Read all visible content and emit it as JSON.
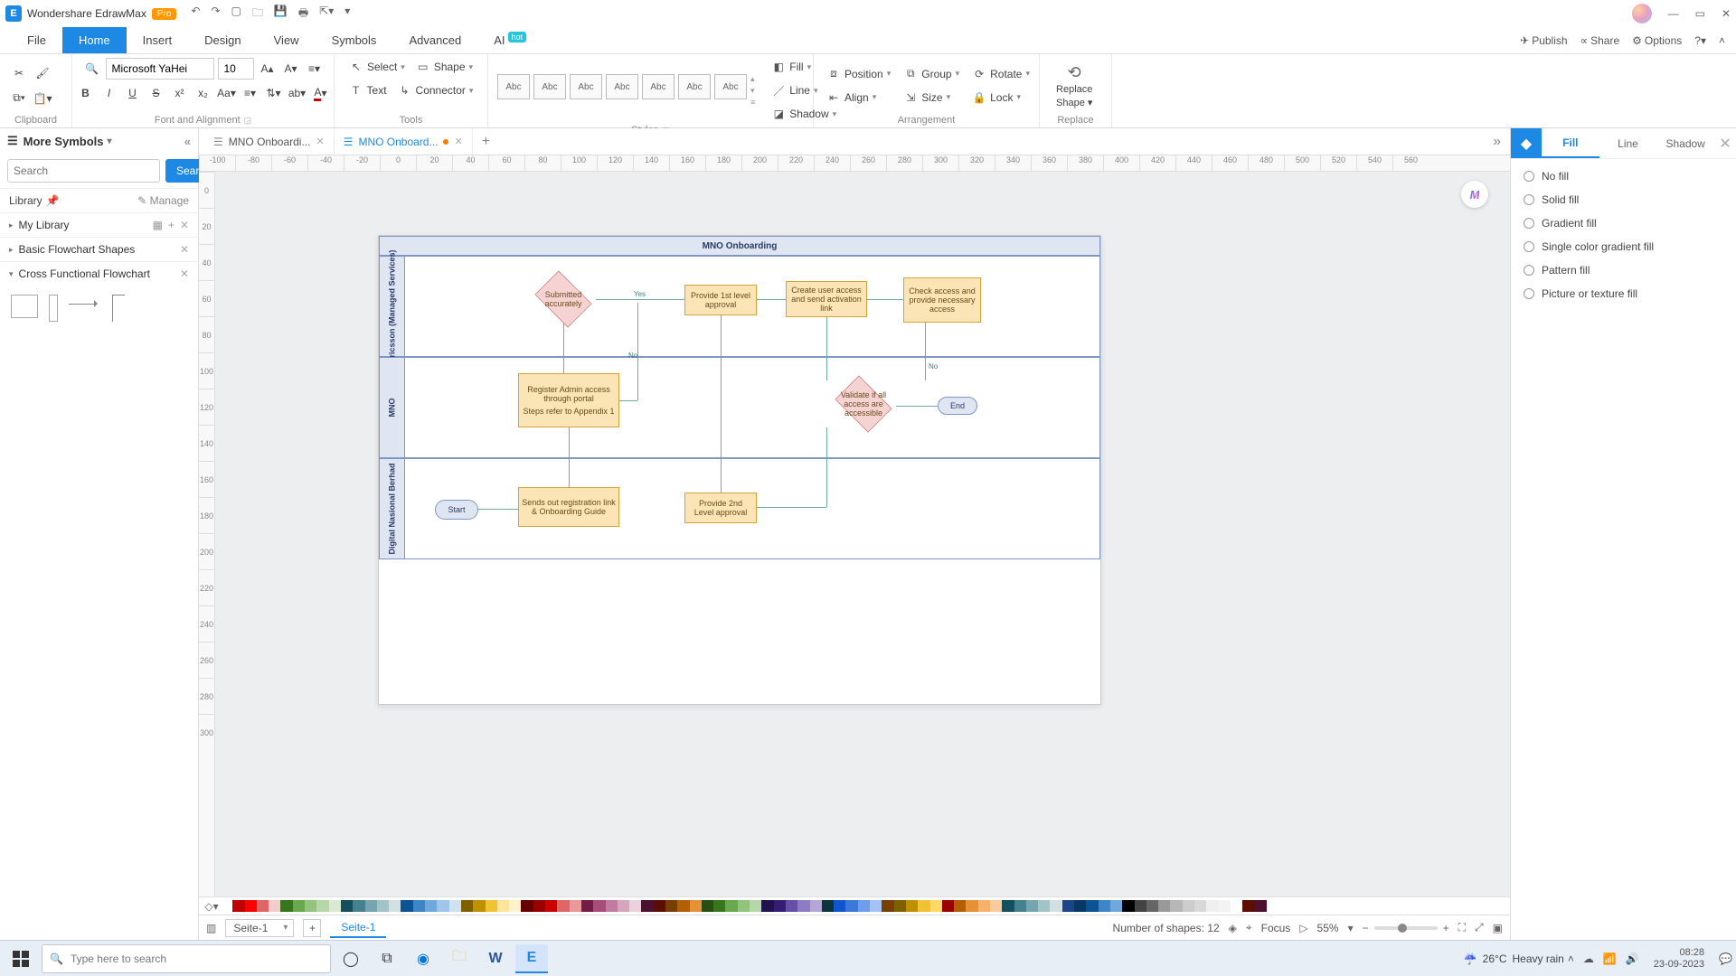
{
  "titlebar": {
    "app": "Wondershare EdrawMax",
    "badge": "Pro"
  },
  "menu": {
    "tabs": [
      "File",
      "Home",
      "Insert",
      "Design",
      "View",
      "Symbols",
      "Advanced",
      "AI"
    ],
    "active": 1,
    "hot": "hot",
    "right": {
      "publish": "Publish",
      "share": "Share",
      "options": "Options"
    }
  },
  "ribbon": {
    "clipboard": {
      "label": "Clipboard"
    },
    "font": {
      "name": "Microsoft YaHei",
      "size": "10",
      "label": "Font and Alignment"
    },
    "tools": {
      "select": "Select",
      "shape": "Shape",
      "text": "Text",
      "connector": "Connector",
      "label": "Tools"
    },
    "styles": {
      "swatch": "Abc",
      "label": "Styles",
      "fill": "Fill",
      "line": "Line",
      "shadow": "Shadow"
    },
    "arrange": {
      "position": "Position",
      "group": "Group",
      "rotate": "Rotate",
      "align": "Align",
      "size": "Size",
      "lock": "Lock",
      "label": "Arrangement"
    },
    "replace": {
      "top": "Replace",
      "bottom": "Shape",
      "label": "Replace"
    }
  },
  "symbols": {
    "title": "More Symbols",
    "search_ph": "Search",
    "search_btn": "Search",
    "library": "Library",
    "manage": "Manage",
    "mylib": "My Library",
    "cat1": "Basic Flowchart Shapes",
    "cat2": "Cross Functional Flowchart"
  },
  "doctabs": {
    "t1": "MNO Onboardi...",
    "t2": "MNO Onboard..."
  },
  "ruler_h": [
    "-100",
    "-80",
    "-60",
    "-40",
    "-20",
    "0",
    "20",
    "40",
    "60",
    "80",
    "100",
    "120",
    "140",
    "160",
    "180",
    "200",
    "220",
    "240",
    "260",
    "280",
    "300",
    "320",
    "340",
    "360",
    "380",
    "400",
    "420",
    "440",
    "460",
    "480",
    "500",
    "520",
    "540",
    "560"
  ],
  "ruler_v": [
    "0",
    "20",
    "40",
    "60",
    "80",
    "100",
    "120",
    "140",
    "160",
    "180",
    "200",
    "220",
    "240",
    "260",
    "280",
    "300"
  ],
  "diagram": {
    "title": "MNO Onboarding",
    "lane1": "Ericsson (Managed Services)",
    "lane2": "MNO",
    "lane3": "Digital Nasional Berhad",
    "start": "Start",
    "end": "End",
    "submitted": "Submitted accurately",
    "provide1": "Provide 1st level approval",
    "create": "Create user access and send activation link",
    "check": "Check access and provide necessary access",
    "register": "Register Admin access through portal",
    "steps": "Steps refer to Appendix 1",
    "sends": "Sends out registration link & Onboarding Guide",
    "provide2": "Provide 2nd Level approval",
    "validate": "Validate if all access are accessible",
    "yes": "Yes",
    "no": "No",
    "ai": "M"
  },
  "format": {
    "tabs": [
      "Fill",
      "Line",
      "Shadow"
    ],
    "opts": [
      "No fill",
      "Solid fill",
      "Gradient fill",
      "Single color gradient fill",
      "Pattern fill",
      "Picture or texture fill"
    ]
  },
  "status": {
    "page": "Seite-1",
    "ptab": "Seite-1",
    "shapes": "Number of shapes: 12",
    "focus": "Focus",
    "zoom": "55%"
  },
  "taskbar": {
    "search": "Type here to search",
    "weather_t": "26°C",
    "weather_s": "Heavy rain",
    "time": "08:28",
    "date": "23-09-2023"
  },
  "colors": [
    "#ffffff",
    "#c00000",
    "#ff0000",
    "#e06666",
    "#f4cccc",
    "#38761d",
    "#6aa84f",
    "#93c47d",
    "#b6d7a8",
    "#d9ead3",
    "#134f5c",
    "#45818e",
    "#76a5af",
    "#a2c4c9",
    "#d0e0e3",
    "#0b5394",
    "#3d85c6",
    "#6fa8dc",
    "#9fc5e8",
    "#cfe2f3",
    "#7f6000",
    "#bf9000",
    "#f1c232",
    "#ffe599",
    "#fff2cc",
    "#660000",
    "#990000",
    "#cc0000",
    "#e06666",
    "#ea9999",
    "#741b47",
    "#a64d79",
    "#c27ba0",
    "#d5a6bd",
    "#ead1dc",
    "#4c1130",
    "#5b0f00",
    "#783f04",
    "#b45f06",
    "#e69138",
    "#274e13",
    "#38761d",
    "#6aa84f",
    "#93c47d",
    "#b6d7a8",
    "#20124d",
    "#351c75",
    "#674ea7",
    "#8e7cc3",
    "#b4a7d6",
    "#0c343d",
    "#1155cc",
    "#3c78d8",
    "#6d9eeb",
    "#a4c2f4",
    "#783f04",
    "#7f6000",
    "#bf9000",
    "#f1c232",
    "#ffd966",
    "#990000",
    "#b45f06",
    "#e69138",
    "#f6b26b",
    "#f9cb9c",
    "#134f5c",
    "#45818e",
    "#76a5af",
    "#a2c4c9",
    "#d0e0e3",
    "#1c4587",
    "#073763",
    "#0b5394",
    "#3d85c6",
    "#6fa8dc",
    "#000000",
    "#434343",
    "#666666",
    "#999999",
    "#b7b7b7",
    "#cccccc",
    "#d9d9d9",
    "#efefef",
    "#f3f3f3",
    "#ffffff",
    "#5b0f00",
    "#4c1130"
  ]
}
